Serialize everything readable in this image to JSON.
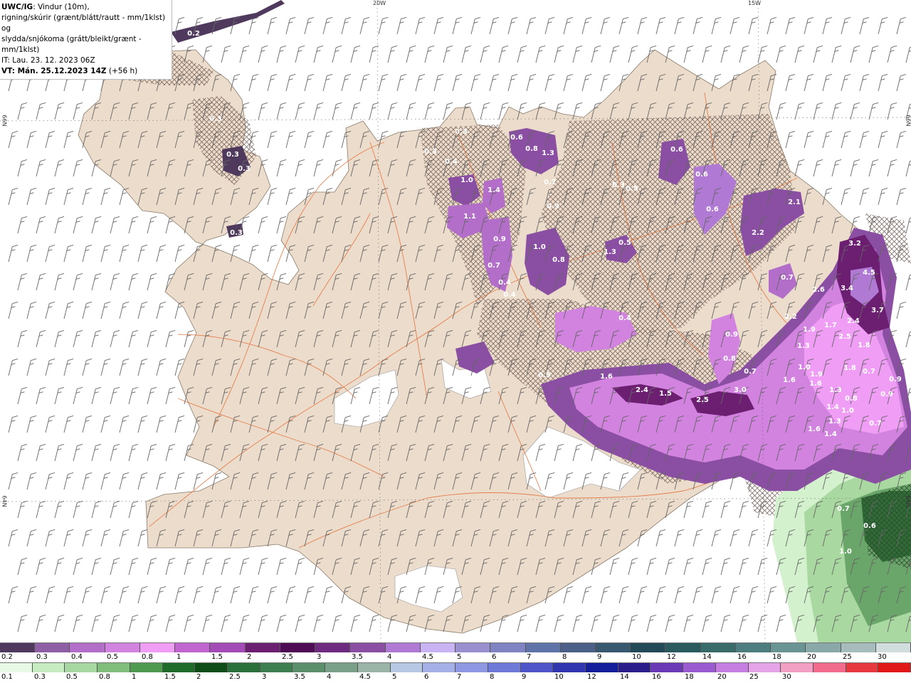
{
  "header": {
    "model": "UWC/IG",
    "line1_rest": ": Vindur (10m),",
    "line2": "rigning/skúrir (grænt/blátt/rautt - mm/1klst) og",
    "line3": "slydda/snjókoma (grátt/bleikt/grænt - mm/1klst)",
    "issue": "IT: Lau. 23. 12. 2023 06Z",
    "valid": "VT: Mán. 25.12.2023 14Z",
    "lead": "(+56 h)"
  },
  "grid_labels": [
    "20W",
    "15W",
    "66N",
    "66N",
    "64N",
    "64N"
  ],
  "value_labels": [
    "0.3",
    "0.3",
    "0.2",
    "0.3",
    "0.3",
    "0.3",
    "0.3",
    "0.3",
    "0.3",
    "0.4",
    "1.0",
    "1.4",
    "1.1",
    "0.9",
    "0.7",
    "0.4",
    "0.4",
    "0.6",
    "0.8",
    "1.3",
    "0.6",
    "0.6",
    "0.6",
    "0.7",
    "0.9",
    "1.0",
    "0.8",
    "1.3",
    "0.5",
    "0.3",
    "2.1",
    "2.2",
    "0.7",
    "0.9",
    "3.2",
    "4.5",
    "3.4",
    "3.7",
    "2.6",
    "2.2",
    "1.9",
    "1.7",
    "2.4",
    "2.5",
    "1.8",
    "1.3",
    "0.5",
    "0.8",
    "0.7",
    "0.4",
    "0.5",
    "1.6",
    "2.4",
    "1.5",
    "2.5",
    "3.0",
    "1.8",
    "1.6",
    "1.0",
    "1.9",
    "1.6",
    "1.3",
    "0.7",
    "0.9",
    "1.4",
    "1.0",
    "0.8",
    "0.9",
    "1.3",
    "1.6",
    "1.4",
    "0.7",
    "0.7",
    "0.6",
    "1.0"
  ],
  "legend_snow": {
    "colors": [
      "#4f3a5e",
      "#8e5fa5",
      "#b26ec9",
      "#d283e0",
      "#f09ef5",
      "#c266cf",
      "#a44ab6",
      "#6c1e71",
      "#4e0c55",
      "#6d2a7f",
      "#8a4fa2",
      "#b07ad4",
      "#c9b3f2",
      "#9a8fcf",
      "#7f83c1",
      "#5f73a8",
      "#4b5f87",
      "#385870",
      "#244a57",
      "#2a5a5e",
      "#3a6b6b",
      "#4d7d7f",
      "#6a9393",
      "#8aa8a8",
      "#a7bdbd",
      "#d1dcdc"
    ],
    "labels": [
      "0.2",
      "0.3",
      "0.4",
      "0.5",
      "0.8",
      "1",
      "1.5",
      "2",
      "2.5",
      "3",
      "3.5",
      "4",
      "4.5",
      "5",
      "6",
      "7",
      "8",
      "9",
      "10",
      "12",
      "14",
      "16",
      "18",
      "20",
      "25",
      "30"
    ]
  },
  "legend_rain": {
    "colors": [
      "#e8fae5",
      "#c8ecc2",
      "#a8d8a2",
      "#7fbf7b",
      "#4e9a4f",
      "#1f6b2a",
      "#0e4d18",
      "#2b6f3a",
      "#3e7f52",
      "#5b8f6c",
      "#7aa08a",
      "#9bb4a8",
      "#b7c8e4",
      "#a6b0e8",
      "#8d97e2",
      "#6f7ad8",
      "#4f55c8",
      "#3136b0",
      "#151e9a",
      "#2c1e8a",
      "#6a3ab6",
      "#9a5ad0",
      "#c67fe0",
      "#e5a3e8",
      "#f3a0c5",
      "#f26a8c",
      "#e8383f",
      "#e01818"
    ],
    "labels": [
      "0.1",
      "0.3",
      "0.5",
      "0.8",
      "1",
      "1.5",
      "2",
      "2.5",
      "3",
      "3.5",
      "4",
      "4.5",
      "5",
      "6",
      "7",
      "8",
      "9",
      "10",
      "12",
      "14",
      "16",
      "18",
      "20",
      "25",
      "30"
    ]
  }
}
